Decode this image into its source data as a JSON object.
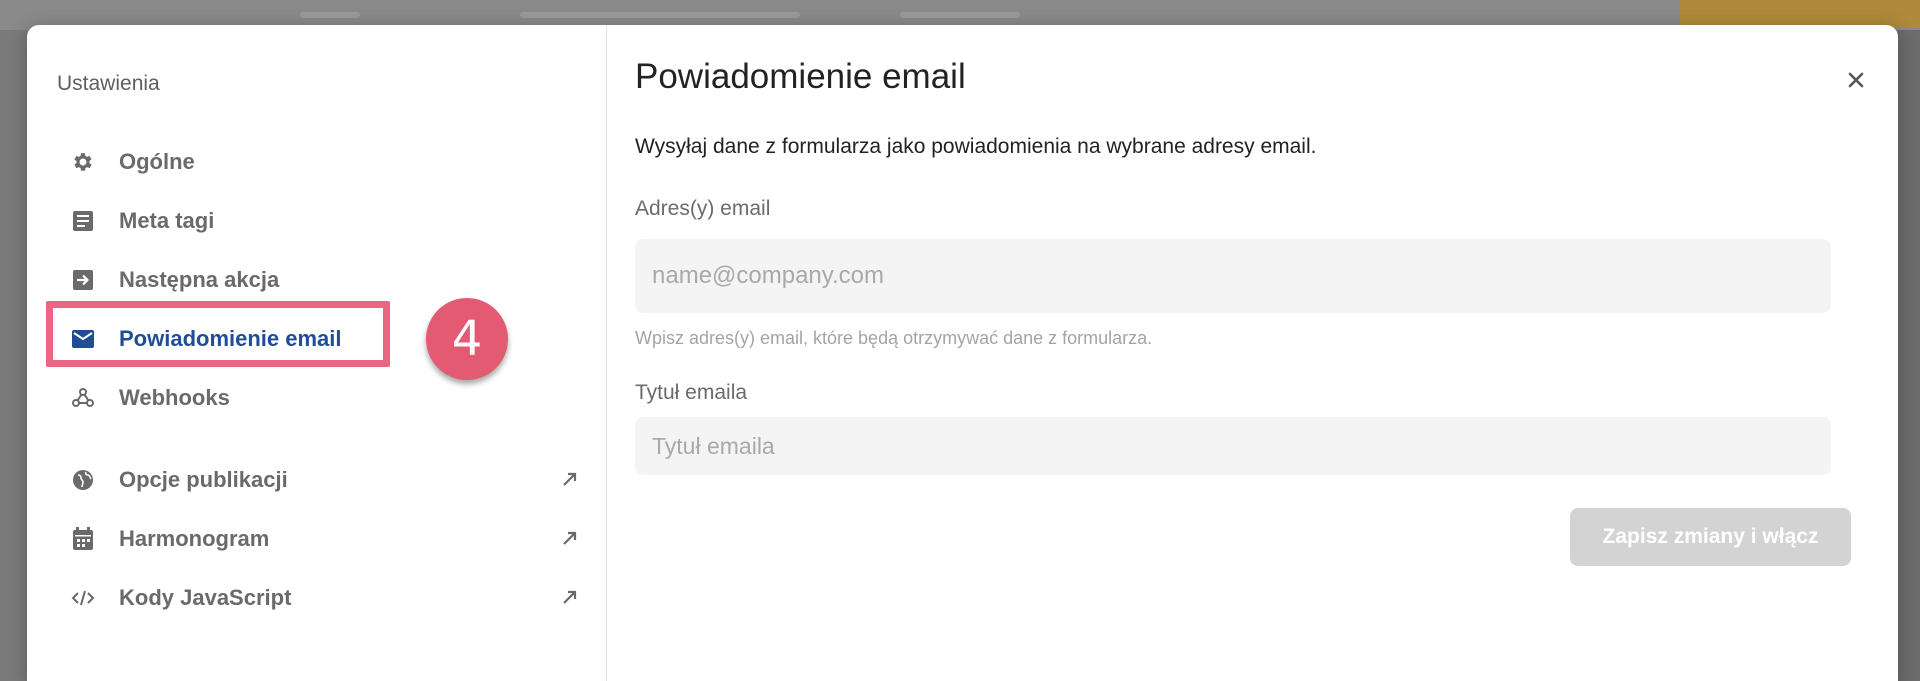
{
  "sidebar": {
    "title": "Ustawienia",
    "items": [
      {
        "label": "Ogólne",
        "icon": "gear-icon"
      },
      {
        "label": "Meta tagi",
        "icon": "document-icon"
      },
      {
        "label": "Następna akcja",
        "icon": "arrow-right-box-icon"
      },
      {
        "label": "Powiadomienie email",
        "icon": "envelope-icon",
        "active": true
      },
      {
        "label": "Webhooks",
        "icon": "webhook-icon"
      },
      {
        "label": "Opcje publikacji",
        "icon": "globe-icon",
        "external": true
      },
      {
        "label": "Harmonogram",
        "icon": "calendar-icon",
        "external": true
      },
      {
        "label": "Kody JavaScript",
        "icon": "code-icon",
        "external": true
      }
    ]
  },
  "annotation": {
    "step_number": "4",
    "highlight_color": "#ec6582",
    "badge_color": "#e25b72"
  },
  "panel": {
    "title": "Powiadomienie email",
    "description": "Wysyłaj dane z formularza jako powiadomienia na wybrane adresy email.",
    "email_field": {
      "label": "Adres(y) email",
      "placeholder": "name@company.com",
      "value": "",
      "help": "Wpisz adres(y) email, które będą otrzymywać dane z formularza."
    },
    "subject_field": {
      "label": "Tytuł emaila",
      "placeholder": "Tytuł emaila",
      "value": ""
    },
    "submit_label": "Zapisz zmiany i włącz",
    "close_icon": "close-icon"
  },
  "colors": {
    "active_nav": "#1f4e96",
    "nav_text": "#6a6a6a",
    "submit_disabled": "#d3d3d3"
  }
}
